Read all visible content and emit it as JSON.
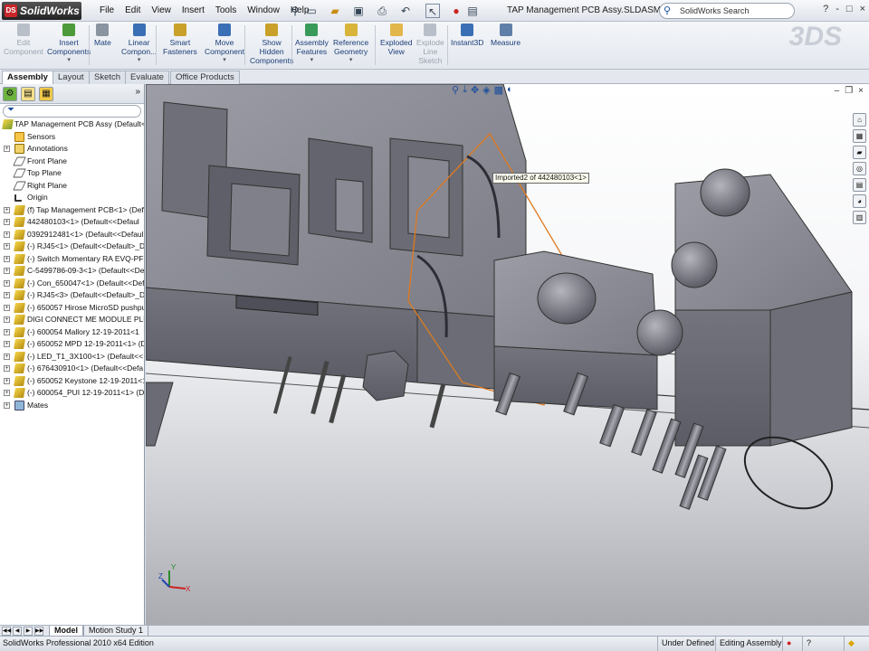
{
  "app": {
    "logo_text": "SolidWorks",
    "menu": [
      "File",
      "Edit",
      "View",
      "Insert",
      "Tools",
      "Window",
      "Help"
    ],
    "document_title": "TAP Management PCB Assy.SLDASM *",
    "search_label": "SolidWorks Search",
    "window_controls": [
      "?",
      "-",
      "□",
      "×"
    ]
  },
  "command_manager": {
    "buttons": [
      {
        "label": "Edit\nComponent",
        "enabled": false
      },
      {
        "label": "Insert\nComponents",
        "enabled": true,
        "dropdown": true
      },
      {
        "label": "Mate",
        "enabled": true
      },
      {
        "label": "Linear\nCompon...",
        "enabled": true,
        "dropdown": true
      },
      {
        "label": "Smart\nFasteners",
        "enabled": true
      },
      {
        "label": "Move\nComponent",
        "enabled": true,
        "dropdown": true
      },
      {
        "label": "Show\nHidden\nComponents",
        "enabled": true
      },
      {
        "label": "Assembly\nFeatures",
        "enabled": true,
        "dropdown": true
      },
      {
        "label": "Reference\nGeometry",
        "enabled": true,
        "dropdown": true
      },
      {
        "label": "Exploded\nView",
        "enabled": true
      },
      {
        "label": "Explode\nLine\nSketch",
        "enabled": false
      },
      {
        "label": "Instant3D",
        "enabled": true
      },
      {
        "label": "Measure",
        "enabled": true
      }
    ]
  },
  "tabs": [
    "Assembly",
    "Layout",
    "Sketch",
    "Evaluate",
    "Office Products"
  ],
  "active_tab": "Assembly",
  "feature_tree": {
    "root": "TAP Management PCB Assy  (Default<D",
    "items": [
      {
        "label": "Sensors",
        "type": "sensor",
        "expand": false
      },
      {
        "label": "Annotations",
        "type": "annot",
        "expand": true
      },
      {
        "label": "Front Plane",
        "type": "plane",
        "expand": false
      },
      {
        "label": "Top Plane",
        "type": "plane",
        "expand": false
      },
      {
        "label": "Right Plane",
        "type": "plane",
        "expand": false
      },
      {
        "label": "Origin",
        "type": "origin",
        "expand": false
      },
      {
        "label": "(f) Tap Management PCB<1> (Defa",
        "type": "part",
        "expand": true
      },
      {
        "label": "442480103<1> (Default<<Defaul",
        "type": "part",
        "expand": true
      },
      {
        "label": "0392912481<1> (Default<<Defaul",
        "type": "part",
        "expand": true
      },
      {
        "label": "(-) RJ45<1> (Default<<Default>_D",
        "type": "part",
        "expand": true
      },
      {
        "label": "(-) Switch Momentary RA EVQ-PF<1",
        "type": "part",
        "expand": true
      },
      {
        "label": "C-5499786-09-3<1> (Default<<De",
        "type": "part",
        "expand": true
      },
      {
        "label": "(-) Con_650047<1> (Default<<Def",
        "type": "part",
        "expand": true
      },
      {
        "label": "(-) RJ45<3> (Default<<Default>_D",
        "type": "part",
        "expand": true
      },
      {
        "label": "(-) 650057 Hirose MicroSD pushpust",
        "type": "part",
        "expand": true
      },
      {
        "label": "DIGI CONNECT ME MODULE PLU",
        "type": "part",
        "expand": true
      },
      {
        "label": "(-) 600054 Mallory 12-19-2011<1",
        "type": "part",
        "expand": true
      },
      {
        "label": "(-) 650052 MPD 12-19-2011<1> (D",
        "type": "part",
        "expand": true
      },
      {
        "label": "(-) LED_T1_3X100<1> (Default<<",
        "type": "part",
        "expand": true
      },
      {
        "label": "(-) 676430910<1> (Default<<Defa",
        "type": "part",
        "expand": true
      },
      {
        "label": "(-) 650052 Keystone 12-19-2011<1",
        "type": "part",
        "expand": true
      },
      {
        "label": "(-) 600054_PUI 12-19-2011<1> (De",
        "type": "part",
        "expand": true
      },
      {
        "label": "Mates",
        "type": "mates",
        "expand": true
      }
    ]
  },
  "viewport": {
    "tooltip": "Imported2 of 442480103<1>",
    "triad": {
      "x": "X",
      "y": "Y",
      "z": "Z"
    }
  },
  "bottom_tabs": [
    "Model",
    "Motion Study 1"
  ],
  "status": {
    "edition": "SolidWorks Professional 2010 x64 Edition",
    "definition": "Under Defined",
    "mode": "Editing Assembly"
  },
  "colors": {
    "accent": "#1a3d78",
    "model_face": "#8c8d96",
    "model_dark": "#5f6069",
    "selection": "#e07a1f"
  }
}
